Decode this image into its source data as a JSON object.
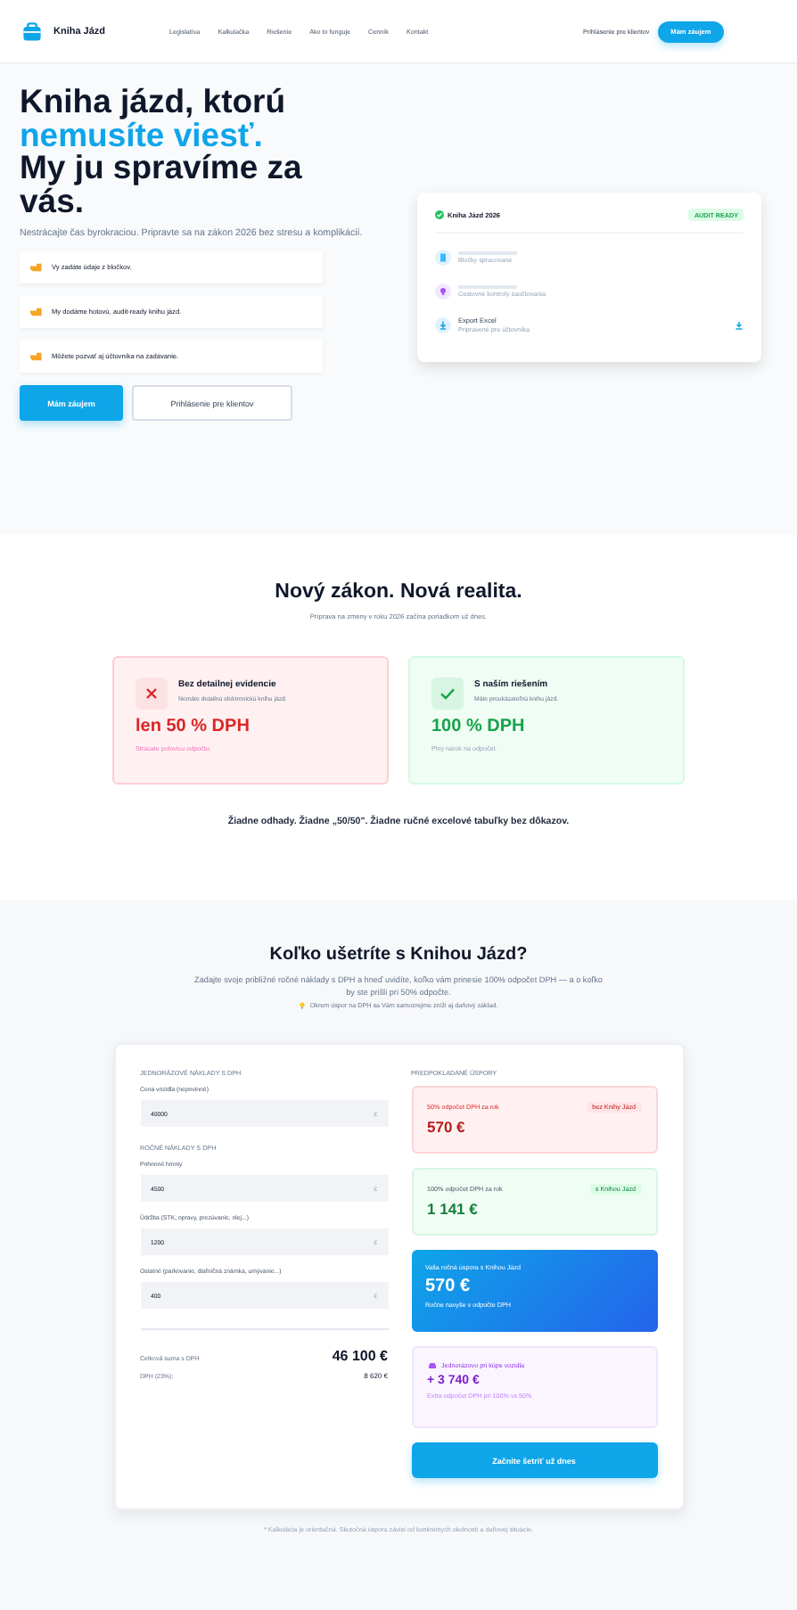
{
  "header": {
    "logo": "Kniha Jázd",
    "nav": [
      "Legislatíva",
      "Kalkulačka",
      "Riešenie",
      "Ako to funguje",
      "Cenník",
      "Kontakt"
    ],
    "login_link": "Prihlásenie pre klientov",
    "cta_button": "Mám záujem"
  },
  "hero": {
    "title_line_1": "Kniha jázd, ktorú",
    "title_highlight": "nemusíte viesť.",
    "title_line_3": "My ju spravíme za vás.",
    "subtitle": "Nestrácajte čas byrokraciou. Pripravte sa na zákon 2026 bez stresu a komplikácií.",
    "points": [
      "Vy zadáte údaje z bločkov.",
      "My dodáme hotovú, audit-ready knihu jázd.",
      "Môžete pozvať aj účtovníka na zadávanie."
    ],
    "primary_button": "Mám záujem",
    "secondary_button": "Prihlásenie pre klientov",
    "preview_card": {
      "title": "Kniha Jázd 2026",
      "badge": "AUDIT READY",
      "rows": [
        {
          "kind": "receipt",
          "title": "",
          "caption": "Bločky spracované"
        },
        {
          "kind": "bulb",
          "title": "",
          "caption": "Cestovné kontroly zaúčtovania"
        },
        {
          "kind": "export",
          "title": "Export Excel",
          "caption": "Pripravené pre účtovníka"
        }
      ]
    }
  },
  "law": {
    "title": "Nový zákon. Nová realita.",
    "subtitle": "Príprava na zmeny v roku 2026 začína poriadkom už dnes.",
    "cards": [
      {
        "kind": "bad",
        "title": "Bez detailnej evidencie",
        "text": "Nemáte detailnú elektronickú knihu jázd.",
        "value": "len 50 % DPH",
        "note": "Strácate polovicu odpočtu."
      },
      {
        "kind": "good",
        "title": "S naším riešením",
        "text": "Máte preukázateľnú knihu jázd.",
        "value": "100 % DPH",
        "note": "Plný nárok na odpočet."
      }
    ],
    "tagline": "Žiadne odhady. Žiadne „50/50\". Žiadne ručné excelové tabuľky bez dôkazov."
  },
  "savings": {
    "title": "Koľko ušetríte s Knihou Jázd?",
    "description": "Zadajte svoje približné ročné náklady s DPH a hneď uvidíte, koľko vám prinesie 100% odpočet DPH — a o koľko by ste prišli pri 50% odpočte.",
    "tip": "Okrem úspor na DPH sa Vám samozrejme zníži aj daňový základ.",
    "calculator": {
      "groups": [
        {
          "heading": "JEDNORÁZOVÉ NÁKLADY S DPH",
          "fields": [
            {
              "label": "Cena vozidla (nepovinné)",
              "value": "40000",
              "unit": "€"
            }
          ]
        },
        {
          "heading": "ROČNÉ NÁKLADY S DPH",
          "fields": [
            {
              "label": "Pohonné hmoty",
              "value": "4500",
              "unit": "€"
            },
            {
              "label": "Údržba (STK, opravy, prezúvanie, olej...)",
              "value": "1200",
              "unit": "€"
            },
            {
              "label": "Ostatné (parkovanie, diaľničná známka, umývanie...)",
              "value": "400",
              "unit": "€"
            }
          ]
        }
      ],
      "totals": [
        {
          "label": "Celková suma s DPH",
          "value": "46 100 €",
          "kind": "big"
        },
        {
          "label": "DPH (23%):",
          "value": "8 620 €",
          "kind": "small"
        }
      ],
      "results_heading": "PREDPOKLADANÉ ÚSPORY",
      "results": [
        {
          "kind": "bad",
          "label": "50% odpočet DPH za rok",
          "badge": "bez Knihy Jázd",
          "value": "570 €"
        },
        {
          "kind": "good",
          "label": "100% odpočet DPH za rok",
          "badge": "s Knihou Jázd",
          "value": "1 141 €"
        },
        {
          "kind": "highlight",
          "label": "Vaša ročná úspora s Knihou Jázd",
          "value": "570 €",
          "note": "Ročne navyše v odpočte DPH"
        },
        {
          "kind": "vehicle",
          "label": "Jednorázovo pri kúpe vozidla",
          "value": "+ 3 740 €",
          "note": "Extra odpočet DPH pri 100% vs 50%"
        }
      ],
      "button": "Začnite šetriť už dnes"
    },
    "footnote": "* Kalkulácia je orientačná. Skutočná úspora závisí od konkrétnych okolností a daňovej situácie."
  }
}
